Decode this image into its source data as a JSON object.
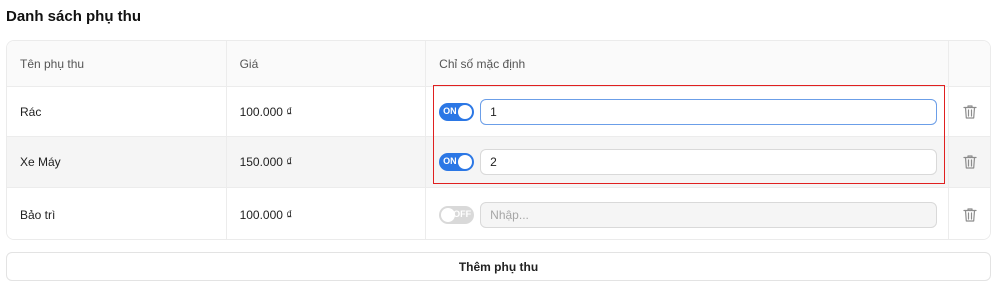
{
  "page": {
    "title": "Danh sách phụ thu"
  },
  "table": {
    "columns": [
      "Tên phụ thu",
      "Giá",
      "Chỉ số mặc định",
      ""
    ],
    "rows": [
      {
        "name": "Rác",
        "price": "100.000 ₫",
        "toggle": "ON",
        "value": "1"
      },
      {
        "name": "Xe Máy",
        "price": "150.000 ₫",
        "toggle": "ON",
        "value": "2"
      },
      {
        "name": "Bảo trì",
        "price": "100.000 ₫",
        "toggle": "OFF",
        "value": "",
        "placeholder": "Nhập..."
      }
    ],
    "delete_icon": "trash-icon"
  },
  "actions": {
    "add_label": "Thêm phụ thu"
  },
  "colors": {
    "accent": "#2b77e5",
    "highlight": "#e02020",
    "toggle_off": "#d9d9d9"
  }
}
